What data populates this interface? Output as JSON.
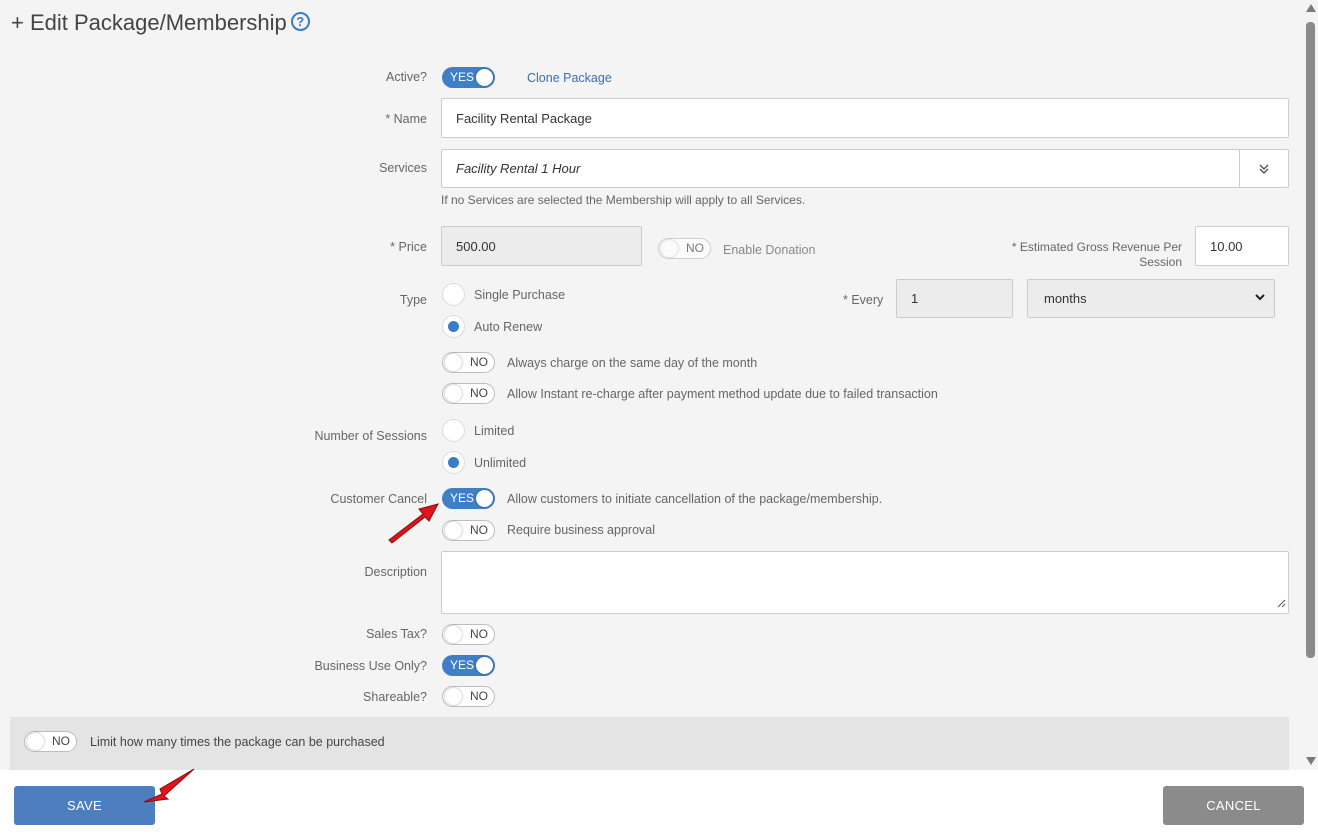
{
  "header": {
    "title": "+ Edit Package/Membership",
    "help_icon": "?"
  },
  "active": {
    "label": "Active?",
    "toggle": "YES",
    "clone_link": "Clone Package"
  },
  "name": {
    "label": "* Name",
    "value": "Facility Rental Package"
  },
  "services": {
    "label": "Services",
    "value": "Facility Rental 1 Hour",
    "hint": "If no Services are selected the Membership will apply to all Services."
  },
  "price": {
    "label": "* Price",
    "value": "500.00",
    "donation_toggle": "NO",
    "donation_label": "Enable Donation"
  },
  "gross_revenue": {
    "label_line1": "* Estimated Gross Revenue Per",
    "label_line2": "Session",
    "value": "10.00"
  },
  "type": {
    "label": "Type",
    "options": [
      "Single Purchase",
      "Auto Renew"
    ],
    "selected": "Auto Renew"
  },
  "every": {
    "label": "* Every",
    "value": "1",
    "unit": "months"
  },
  "same_day": {
    "toggle": "NO",
    "label": "Always charge on the same day of the month"
  },
  "instant_recharge": {
    "toggle": "NO",
    "label": "Allow Instant re-charge after payment method update due to failed transaction"
  },
  "sessions": {
    "label": "Number of Sessions",
    "options": [
      "Limited",
      "Unlimited"
    ],
    "selected": "Unlimited"
  },
  "customer_cancel": {
    "label": "Customer Cancel",
    "toggle": "YES",
    "text": "Allow customers to initiate cancellation of the package/membership.",
    "approval_toggle": "NO",
    "approval_text": "Require business approval"
  },
  "description": {
    "label": "Description",
    "value": ""
  },
  "sales_tax": {
    "label": "Sales Tax?",
    "toggle": "NO"
  },
  "business_use": {
    "label": "Business Use Only?",
    "toggle": "YES"
  },
  "shareable": {
    "label": "Shareable?",
    "toggle": "NO"
  },
  "limit": {
    "toggle": "NO",
    "label": "Limit how many times the package can be purchased"
  },
  "footer": {
    "save": "SAVE",
    "cancel": "CANCEL"
  },
  "colors": {
    "accent": "#3f7fc6",
    "annotation_arrow": "#e0141b"
  }
}
